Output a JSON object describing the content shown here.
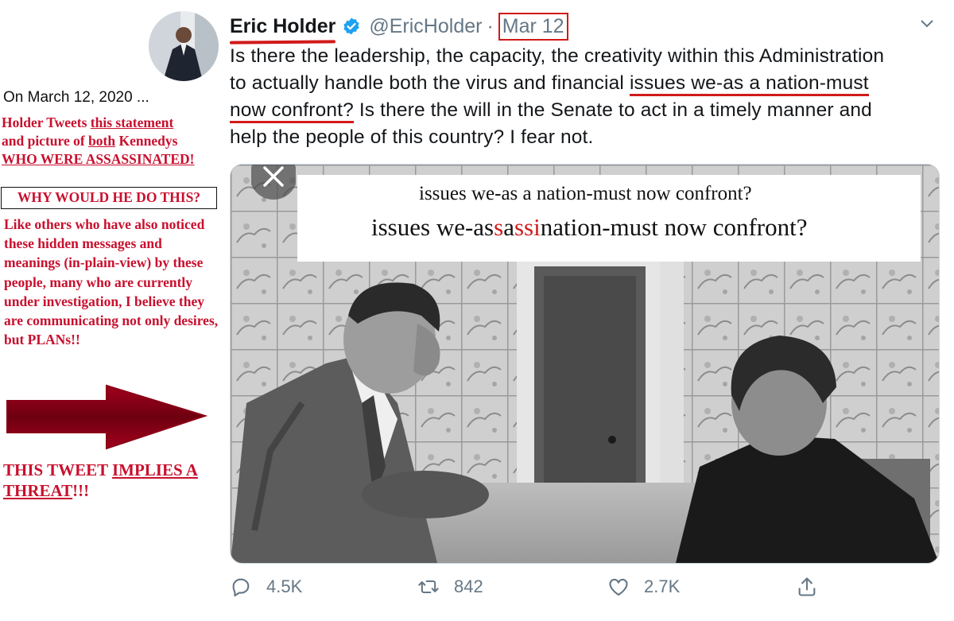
{
  "tweet": {
    "author_name": "Eric Holder",
    "handle": "@EricHolder",
    "separator": "·",
    "date": "Mar 12",
    "text_lines": [
      "Is there the leadership, the capacity, the creativity within this Administration",
      "to actually handle both the virus and financial ",
      "issues we-as a nation-must",
      "now confront?",
      " Is there the will in the Senate to act in a timely manner and",
      "help the people of this country?  I fear not."
    ]
  },
  "media": {
    "overlay_line1": "issues we-as a nation-must now confront?",
    "overlay_line2_parts": [
      "issues we-as",
      "s",
      "a",
      "ss",
      "i",
      "nation-must now confront?"
    ]
  },
  "annotation": {
    "date_line": "On March 12, 2020 ...",
    "line1a": "Holder Tweets ",
    "line1b": "this statement",
    "line2a": "and picture of ",
    "line2b": "both",
    "line2c": " Kennedys",
    "line3a": "WHO WERE ",
    "line3b": "ASSASSINATED!",
    "box_text": "WHY WOULD HE DO THIS?",
    "paragraph": "Like others who have also noticed these hidden messages and meanings (in-plain-view) by these people, many who are currently under investigation, I believe they are communicating not only desires, but PLANs!!",
    "threat_a": "THIS TWEET ",
    "threat_b": "IMPLIES A",
    "threat_c": "THREAT",
    "threat_d": "!!!"
  },
  "actions": {
    "reply_count": "4.5K",
    "retweet_count": "842",
    "like_count": "2.7K"
  },
  "icons": [
    "verified-icon",
    "chevron-down-icon",
    "close-icon",
    "reply-icon",
    "retweet-icon",
    "like-icon",
    "share-icon"
  ],
  "colors": {
    "accent_red": "#d11a1a",
    "annotation_red": "#c8102e",
    "verified_blue": "#1da1f2",
    "muted": "#657786"
  }
}
